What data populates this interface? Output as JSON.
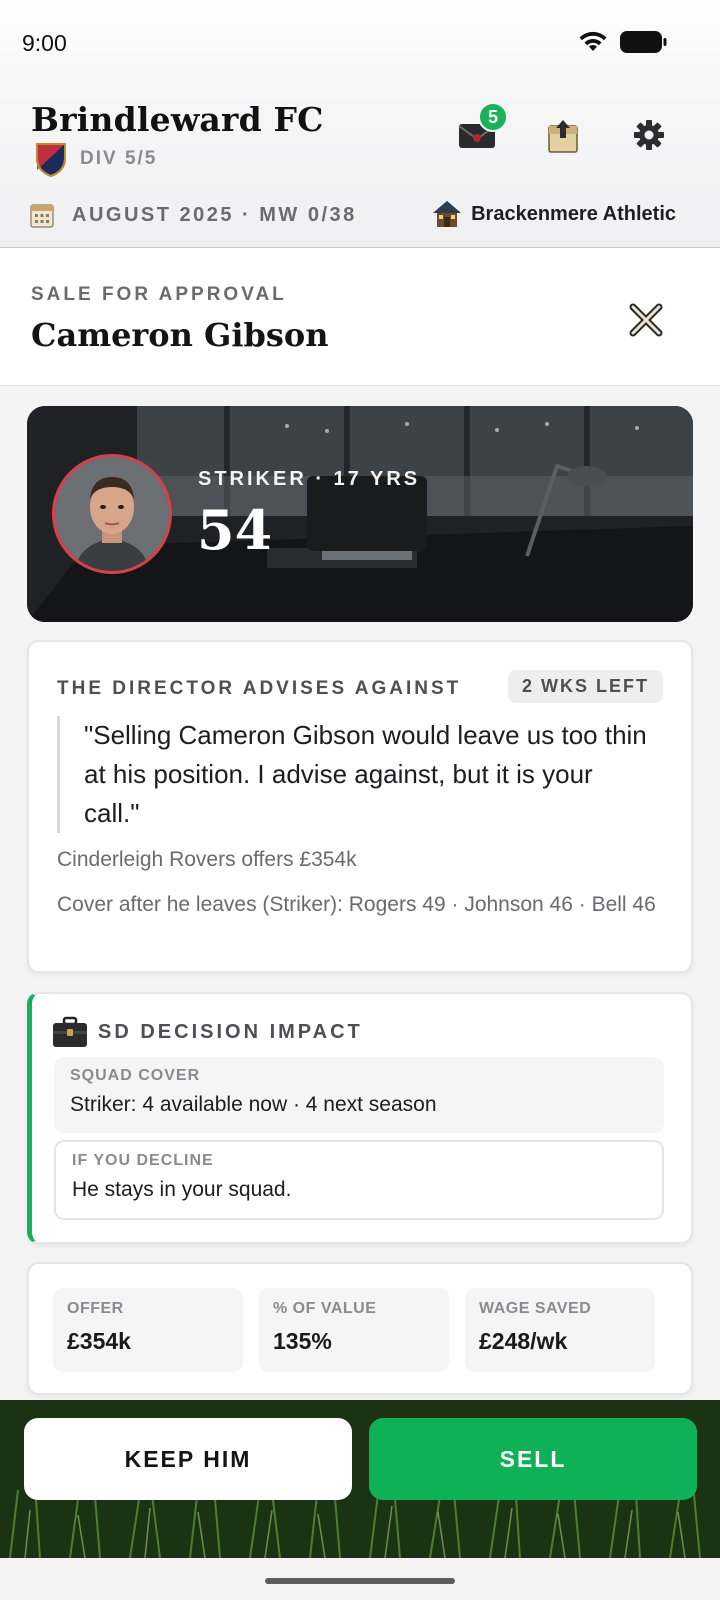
{
  "status_bar": {
    "time": "9:00"
  },
  "club": {
    "name": "Brindleward FC",
    "division": "DIV 5/5",
    "mail_count": "5",
    "date": "AUGUST 2025 · MW 0/38",
    "home_opponent": "Brackenmere Athletic",
    "crest_colors": [
      "#c8303c",
      "#1e2a5e"
    ]
  },
  "icons": {
    "mail": "mail-icon",
    "transfer": "transfer-upload-icon",
    "settings": "gear-icon",
    "calendar": "calendar-icon",
    "home": "home-icon",
    "close": "close-icon",
    "briefcase": "briefcase-icon"
  },
  "sheet": {
    "eyebrow": "SALE FOR APPROVAL",
    "title": "Cameron Gibson",
    "close": "close"
  },
  "player": {
    "role": "STRIKER · 17 YRS",
    "rating": "54"
  },
  "director": {
    "title": "THE DIRECTOR ADVISES AGAINST",
    "deadline": "2 WKS LEFT",
    "quote": "\"Selling Cameron Gibson would leave us too thin at his position. I advise against, but it is your call.\"",
    "offer": "Cinderleigh Rovers offers £354k",
    "cover": "Cover after he leaves (Striker): Rogers 49 · Johnson 46 · Bell 46"
  },
  "impact": {
    "title": "SD DECISION IMPACT",
    "squad_cover_label": "SQUAD COVER",
    "squad_cover_value": "Striker: 4 available now · 4 next season",
    "decline_label": "IF YOU DECLINE",
    "decline_value": "He stays in your squad.",
    "accent": "#14b05a"
  },
  "stats": [
    {
      "label": "OFFER",
      "value": "£354k"
    },
    {
      "label": "% OF VALUE",
      "value": "135%"
    },
    {
      "label": "WAGE SAVED",
      "value": "£248/wk"
    }
  ],
  "actions": {
    "keep": "KEEP HIM",
    "sell": "SELL",
    "sell_color": "#0fb158"
  }
}
